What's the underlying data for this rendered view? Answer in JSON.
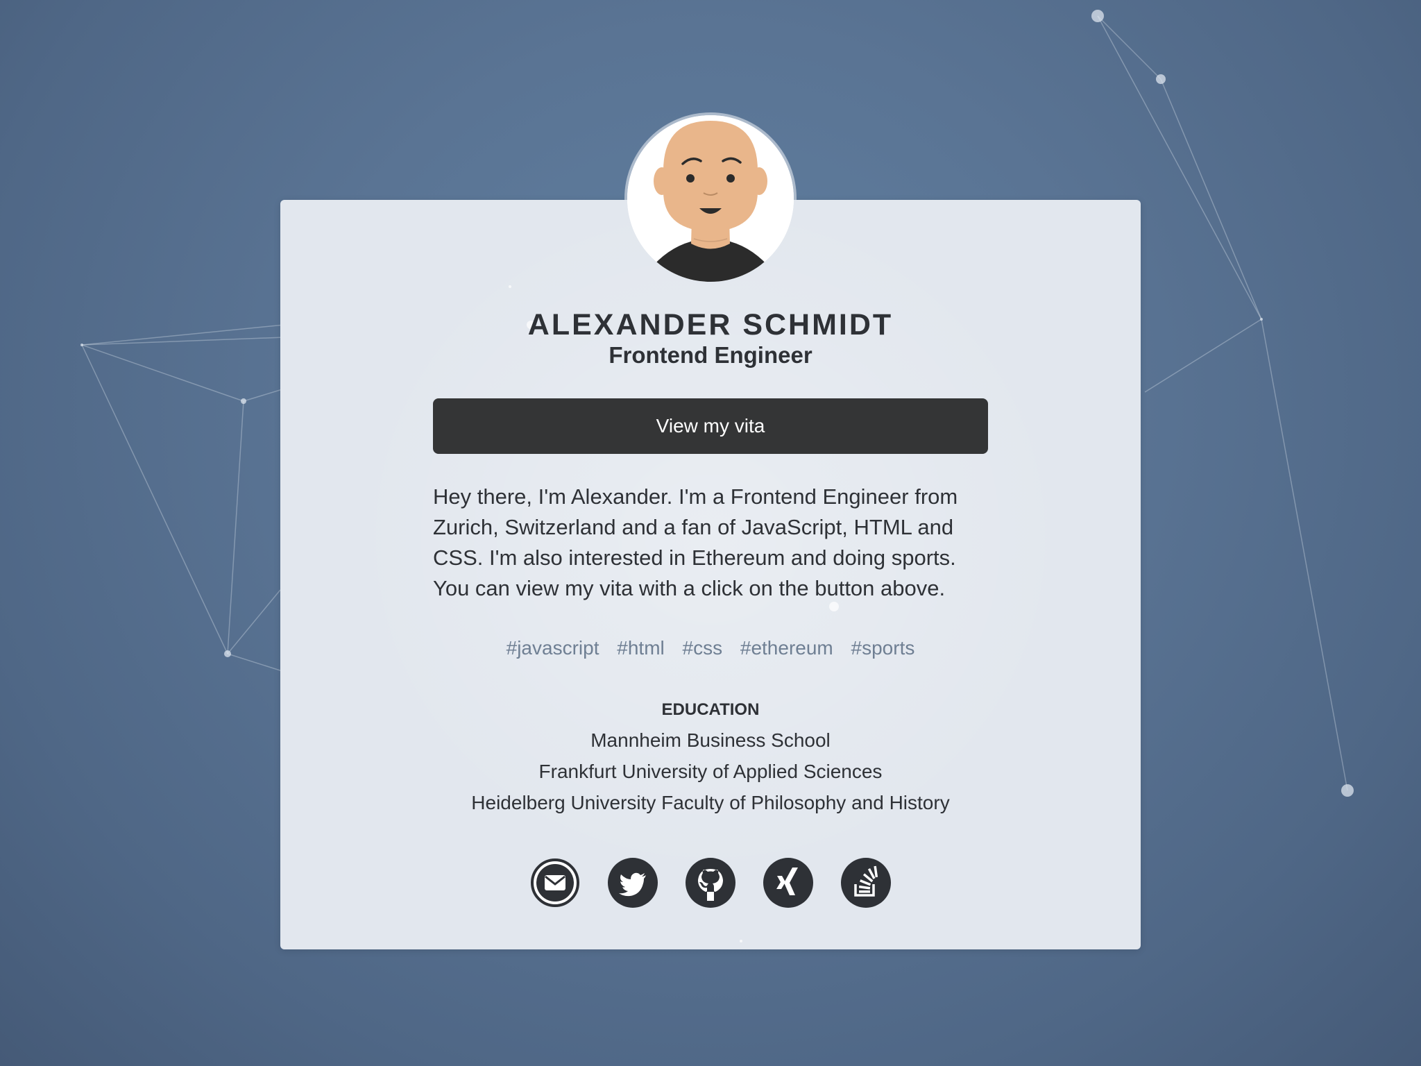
{
  "profile": {
    "name": "ALEXANDER SCHMIDT",
    "role": "Frontend Engineer",
    "vita_button_label": "View my vita",
    "bio": "Hey there, I'm Alexander. I'm a Frontend Engineer from Zurich, Switzerland and a fan of JavaScript, HTML and CSS. I'm also interested in Ethereum and doing sports. You can view my vita with a click on the button above."
  },
  "tags": [
    "#javascript",
    "#html",
    "#css",
    "#ethereum",
    "#sports"
  ],
  "education": {
    "heading": "EDUCATION",
    "items": [
      "Mannheim Business School",
      "Frankfurt University of Applied Sciences",
      "Heidelberg University Faculty of Philosophy and History"
    ]
  },
  "socials": [
    {
      "icon": "mail-icon"
    },
    {
      "icon": "twitter-icon"
    },
    {
      "icon": "github-icon"
    },
    {
      "icon": "xing-icon"
    },
    {
      "icon": "stackoverflow-icon"
    }
  ],
  "colors": {
    "background": "#5a7494",
    "card": "#e2e7ee",
    "button": "#343536",
    "text": "#2e3136",
    "tag": "#6f7f93"
  }
}
